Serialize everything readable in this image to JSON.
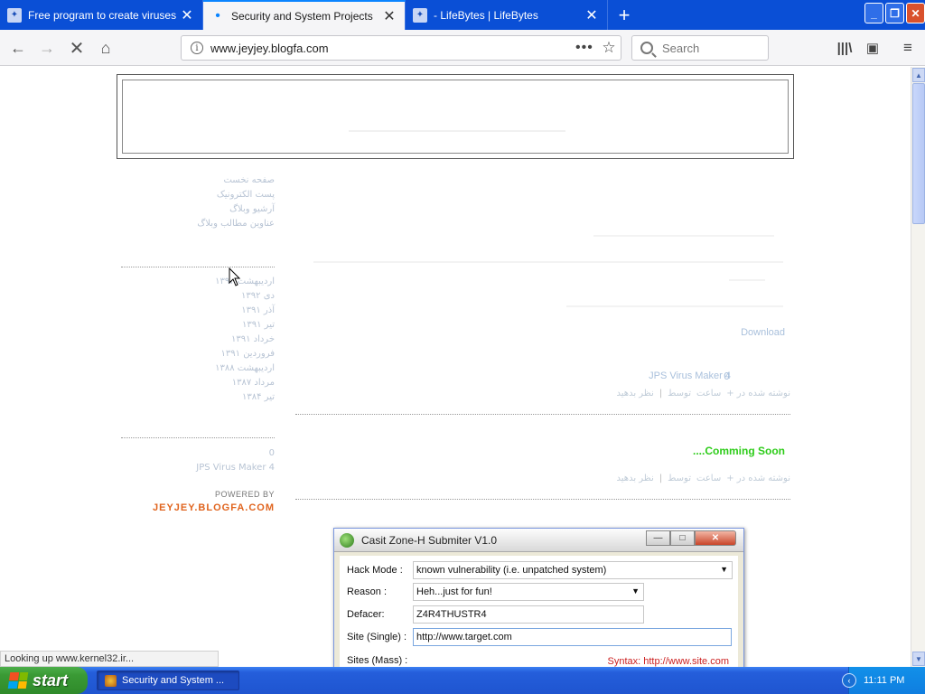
{
  "tabs": [
    {
      "title": "Free program to create viruses ea",
      "active": false
    },
    {
      "title": "Security and System Projects",
      "active": true
    },
    {
      "title": "- LifeBytes | LifeBytes",
      "active": false
    }
  ],
  "navbar": {
    "url": "www.jeyjey.blogfa.com",
    "search_placeholder": "Search"
  },
  "sidebar": {
    "links": [
      "صفحه نخست",
      "پست الکترونیک",
      "آرشیو وبلاگ",
      "عناوین مطالب وبلاگ"
    ],
    "archive": [
      "اردیبهشت ۱۳۹۲",
      "دی ۱۳۹۲",
      "آذر ۱۳۹۱",
      "تیر ۱۳۹۱",
      "خرداد ۱۳۹۱",
      "فروردین ۱۳۹۱",
      "اردیبهشت ۱۳۸۸",
      "مرداد ۱۳۸۷",
      "تیر ۱۳۸۴"
    ],
    "recent": [
      "0",
      "JPS Virus Maker 4"
    ],
    "powered_by": "POWERED BY",
    "powered_site": "JEYJEY.BLOGFA.COM"
  },
  "main": {
    "download": "Download",
    "post1_title": "JPS Virus Maker 4",
    "post1_count": "0",
    "post_meta": [
      "+ نوشته شده در",
      "ساعت",
      "توسط",
      "|",
      "نظر بدهید"
    ],
    "coming_soon": "....Comming Soon"
  },
  "dialog": {
    "title": "Casit Zone-H Submiter V1.0",
    "hack_mode_label": "Hack Mode :",
    "hack_mode_value": "known vulnerability (i.e. unpatched system)",
    "reason_label": "Reason :",
    "reason_value": "Heh...just for fun!",
    "defacer_label": "Defacer:",
    "defacer_value": "Z4R4THUSTR4",
    "site_single_label": "Site (Single) :",
    "site_single_value": "http://www.target.com",
    "sites_mass_label": "Sites (Mass) :",
    "syntax_hint": "Syntax: http://www.site.com"
  },
  "status_text": "Looking up www.kernel32.ir...",
  "taskbar": {
    "start_label": "start",
    "task_item": "Security and System ...",
    "clock": "11:11 PM"
  },
  "icons": {
    "back": "back-arrow-icon",
    "forward": "forward-arrow-icon",
    "stop": "stop-icon",
    "home": "home-icon",
    "library": "library-icon",
    "sidebar": "sidebar-icon",
    "menu": "hamburger-menu-icon"
  },
  "colors": {
    "tabbar": "#0a4fd6",
    "accent": "#0a84ff",
    "powered_site": "#e0641e",
    "coming_soon": "#2ecc1a",
    "syntax": "#cc2020"
  }
}
